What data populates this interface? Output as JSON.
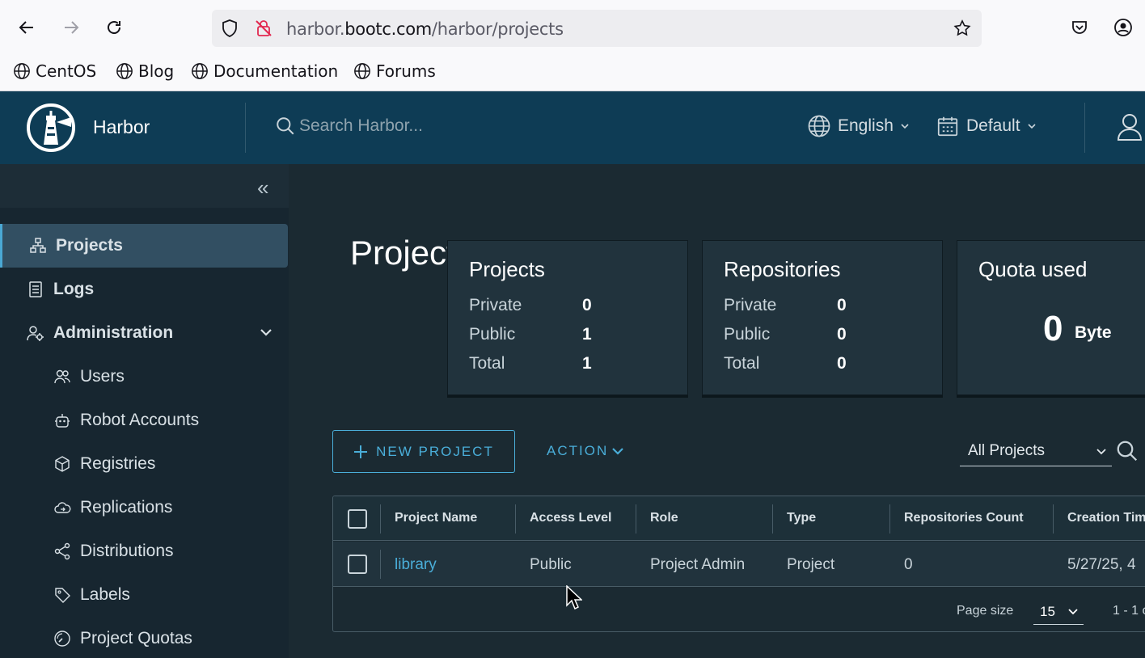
{
  "browser": {
    "url_prefix": "harbor.",
    "url_domain": "bootc.com",
    "url_path": "/harbor/projects",
    "bookmarks": [
      {
        "label": "CentOS"
      },
      {
        "label": "Blog"
      },
      {
        "label": "Documentation"
      },
      {
        "label": "Forums"
      }
    ]
  },
  "header": {
    "brand": "Harbor",
    "search_placeholder": "Search Harbor...",
    "language": "English",
    "theme": "Default"
  },
  "sidebar": {
    "collapse_label": "«",
    "items": [
      {
        "label": "Projects",
        "icon": "projects-icon"
      },
      {
        "label": "Logs",
        "icon": "logs-icon"
      },
      {
        "label": "Administration",
        "icon": "admin-icon"
      },
      {
        "label": "Users",
        "icon": "users-icon"
      },
      {
        "label": "Robot Accounts",
        "icon": "robot-icon"
      },
      {
        "label": "Registries",
        "icon": "cube-icon"
      },
      {
        "label": "Replications",
        "icon": "cloud-icon"
      },
      {
        "label": "Distributions",
        "icon": "share-icon"
      },
      {
        "label": "Labels",
        "icon": "tag-icon"
      },
      {
        "label": "Project Quotas",
        "icon": "gauge-icon"
      }
    ]
  },
  "main": {
    "title": "Projects",
    "cards": {
      "projects": {
        "title": "Projects",
        "private_label": "Private",
        "private": "0",
        "public_label": "Public",
        "public": "1",
        "total_label": "Total",
        "total": "1"
      },
      "repositories": {
        "title": "Repositories",
        "private_label": "Private",
        "private": "0",
        "public_label": "Public",
        "public": "0",
        "total_label": "Total",
        "total": "0"
      },
      "quota": {
        "title": "Quota used",
        "value": "0",
        "unit": "Byte"
      }
    },
    "new_project_label": "NEW PROJECT",
    "action_label": "ACTION",
    "filter_value": "All Projects",
    "table": {
      "columns": [
        "Project Name",
        "Access Level",
        "Role",
        "Type",
        "Repositories Count",
        "Creation Tim"
      ],
      "rows": [
        {
          "name": "library",
          "access": "Public",
          "role": "Project Admin",
          "type": "Project",
          "repo_count": "0",
          "created": "5/27/25, 4"
        }
      ],
      "page_size_label": "Page size",
      "page_size": "15",
      "pager_text": "1 - 1 c"
    }
  },
  "colors": {
    "header_bg": "#0e3c55",
    "sidebar_bg": "#172630",
    "main_bg": "#1b2a32",
    "accent": "#4aaed9"
  }
}
